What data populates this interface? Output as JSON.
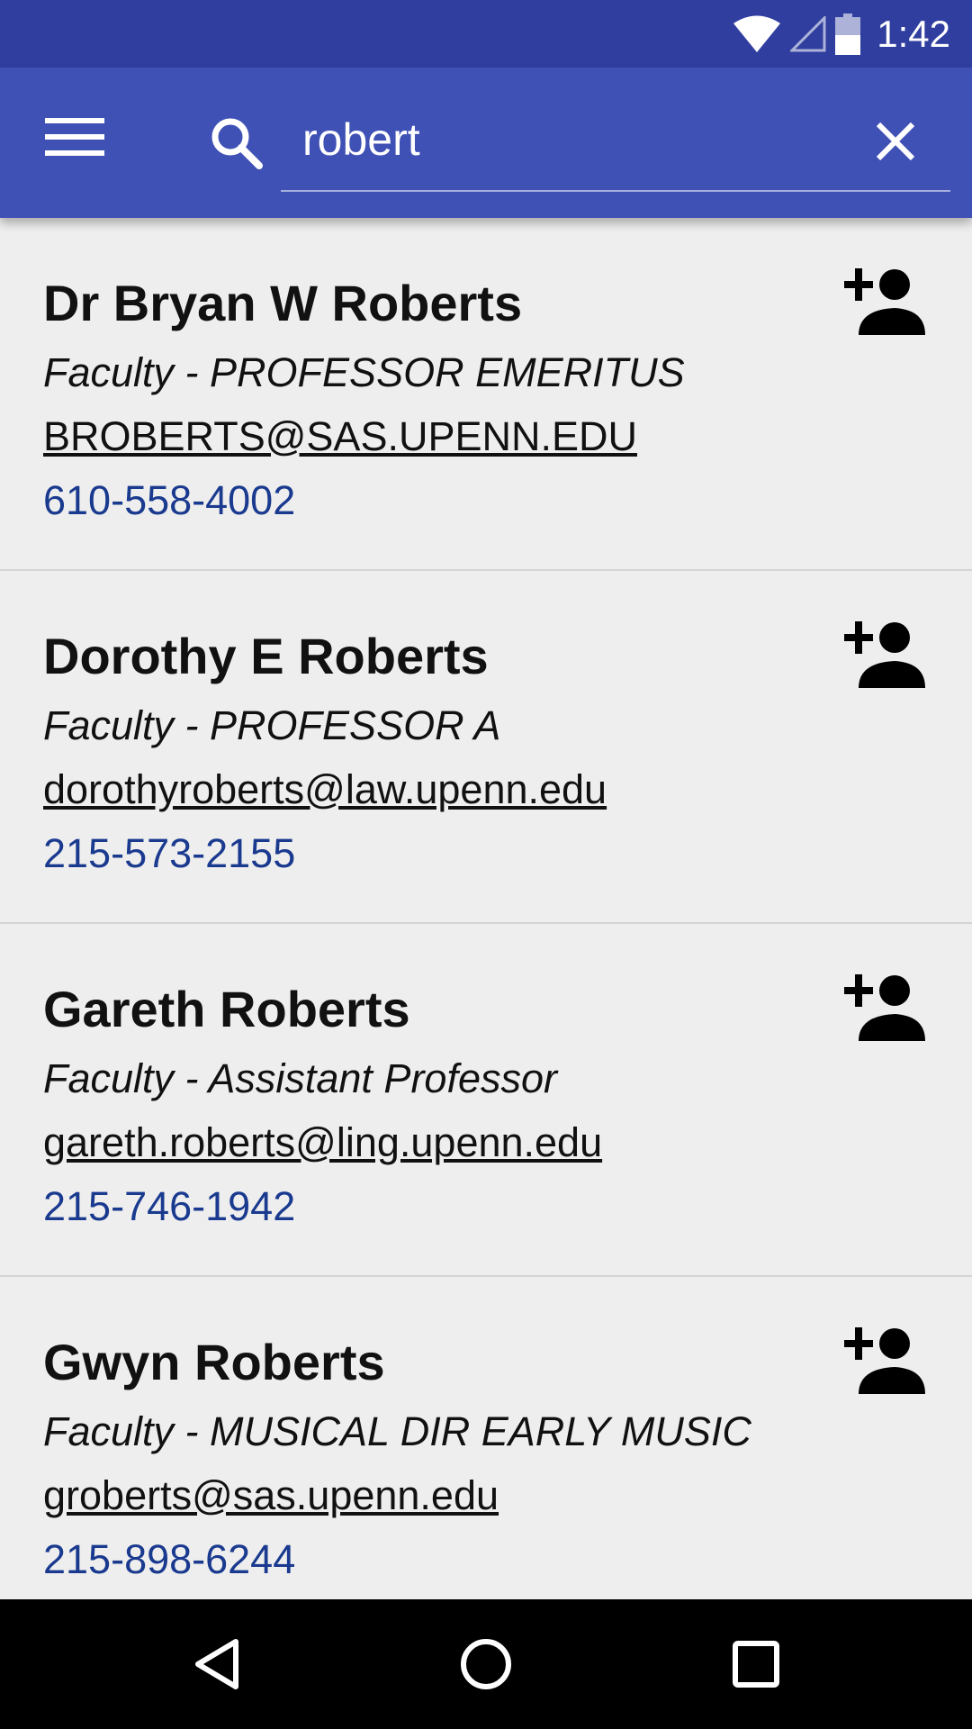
{
  "status_bar": {
    "time": "1:42",
    "icons": [
      "wifi-icon",
      "cell-signal-icon",
      "battery-icon"
    ]
  },
  "app_bar": {
    "menu_icon": "menu-icon",
    "search_icon": "search-icon",
    "search_value": "robert",
    "close_icon": "close-icon"
  },
  "results": [
    {
      "name": "Dr Bryan W Roberts",
      "title": "Faculty - PROFESSOR EMERITUS",
      "email": "BROBERTS@SAS.UPENN.EDU",
      "phone": "610-558-4002"
    },
    {
      "name": "Dorothy E Roberts",
      "title": "Faculty - PROFESSOR A",
      "email": "dorothyroberts@law.upenn.edu",
      "phone": "215-573-2155"
    },
    {
      "name": "Gareth Roberts",
      "title": "Faculty - Assistant Professor",
      "email": "gareth.roberts@ling.upenn.edu",
      "phone": "215-746-1942"
    },
    {
      "name": "Gwyn Roberts",
      "title": "Faculty - MUSICAL DIR EARLY MUSIC",
      "email": "groberts@sas.upenn.edu",
      "phone": "215-898-6244"
    }
  ],
  "nav_bar": {
    "buttons": [
      "back-icon",
      "home-icon",
      "recents-icon"
    ]
  },
  "colors": {
    "status_bar": "#303f9f",
    "app_bar": "#3f51b5",
    "background": "#eeeeee",
    "phone_text": "#1a3a8f"
  }
}
